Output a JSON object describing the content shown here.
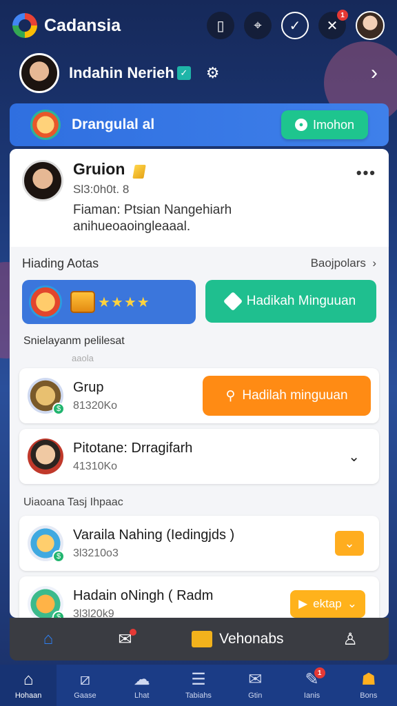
{
  "app": {
    "name": "Cadansia"
  },
  "top_icons": [
    {
      "name": "tablet-icon",
      "glyph": "▯"
    },
    {
      "name": "scan-icon",
      "glyph": "⌖"
    },
    {
      "name": "check-circle-icon",
      "glyph": "✓"
    },
    {
      "name": "x-logo-icon",
      "glyph": "✕",
      "badge": "1"
    }
  ],
  "user": {
    "name": "Indahin Nerieh",
    "verified_glyph": "✓"
  },
  "banner": {
    "title": "Drangulal al",
    "button_label": "Imohon"
  },
  "post": {
    "author": "Gruion",
    "id_line": "Sl3:0h0t. 8",
    "text_line1": "Fiaman: Ptsian Nangehiarh",
    "text_line2": "anihueoaoingleaaal."
  },
  "section1": {
    "title": "Hiading Aotas",
    "link": "Baojpolars"
  },
  "rewards": {
    "green_label": "Hadikah Minguuan",
    "stars": "★★★★"
  },
  "caption": "Snielayanm pelilesat",
  "faint_divider": "aaola",
  "cards": [
    {
      "title": "Grup",
      "sub": "81320Ko",
      "action": "Hadilah minguuan"
    },
    {
      "title": "Pitotane: Drragifarh",
      "sub": "41310Ko"
    }
  ],
  "section2": {
    "title": "Uiaoana Tasj Ihpaac"
  },
  "cards2": [
    {
      "title": "Varaila Nahing (Iedingjds )",
      "sub": "3l3210o3"
    },
    {
      "title": "Hadain oNingh ( Radm",
      "sub": "3l3l20k9",
      "action": "ektap"
    }
  ],
  "action_bar": {
    "center_label": "Vehonabs"
  },
  "bottom_nav": [
    {
      "label": "Hohaan",
      "glyph": "⌂"
    },
    {
      "label": "Gaase",
      "glyph": "⧄"
    },
    {
      "label": "Lhat",
      "glyph": "☁"
    },
    {
      "label": "Tabiahs",
      "glyph": "☰"
    },
    {
      "label": "Gtin",
      "glyph": "✉"
    },
    {
      "label": "Ianis",
      "glyph": "✎",
      "badge": "1"
    },
    {
      "label": "Bons",
      "glyph": "☗"
    }
  ],
  "colors": {
    "banner_blue": "#2f6fe0",
    "green": "#1ec58e",
    "orange": "#ff8b14",
    "nav_blue": "#1b3c86"
  }
}
